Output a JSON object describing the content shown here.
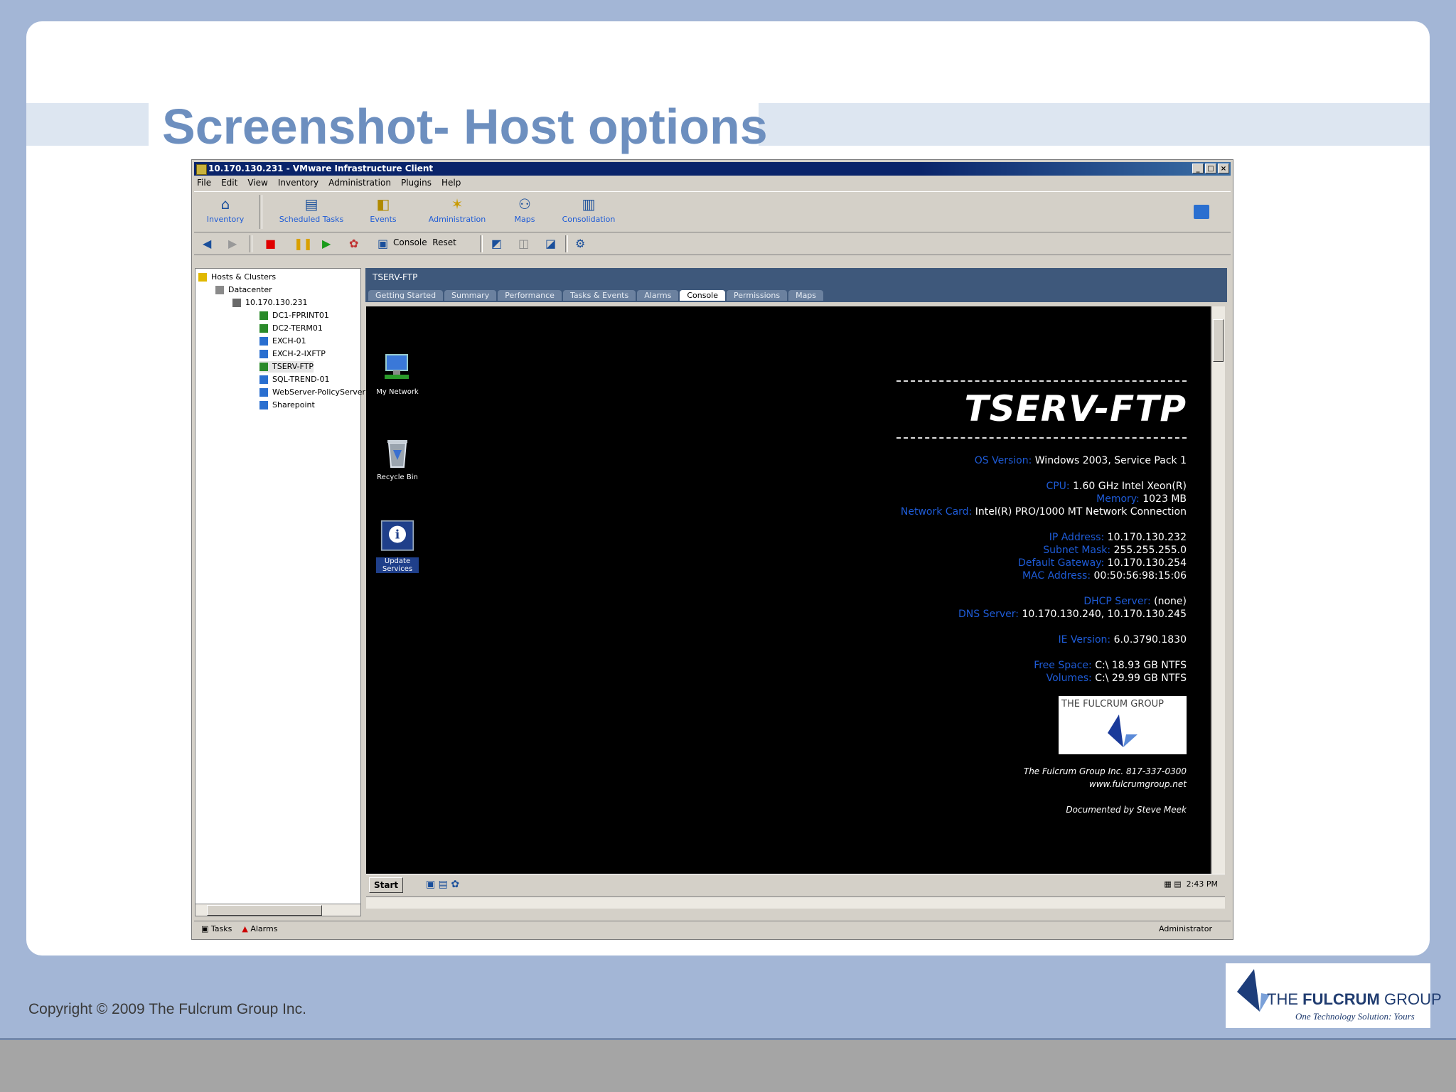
{
  "slide": {
    "title": "Screenshot- Host options",
    "copyright": "Copyright © 2009 The Fulcrum Group Inc.",
    "brand": {
      "name_pre": "THE ",
      "name_bold": "FULCRUM",
      "name_post": " GROUP",
      "tagline": "One Technology Solution: Yours"
    }
  },
  "window": {
    "title": "10.170.130.231 - VMware Infrastructure Client",
    "menu": [
      "File",
      "Edit",
      "View",
      "Inventory",
      "Administration",
      "Plugins",
      "Help"
    ],
    "toolbar": [
      "Inventory",
      "Scheduled Tasks",
      "Events",
      "Administration",
      "Maps",
      "Consolidation"
    ],
    "console_label": "Console",
    "reset_label": "Reset",
    "tree": [
      "Hosts & Clusters",
      "Datacenter",
      "10.170.130.231",
      "DC1-FPRINT01",
      "DC2-TERM01",
      "EXCH-01",
      "EXCH-2-IXFTP",
      "TSERV-FTP",
      "SQL-TREND-01",
      "WebServer-PolicyServer",
      "Sharepoint"
    ],
    "panel_title": "TSERV-FTP",
    "tabs": [
      "Getting Started",
      "Summary",
      "Performance",
      "Tasks & Events",
      "Alarms",
      "Console",
      "Permissions",
      "Maps"
    ],
    "active_tab": "Console",
    "status_left": [
      "Tasks",
      "Alarms"
    ],
    "status_right": "Administrator"
  },
  "desktop": {
    "icons": [
      "My Network",
      "Recycle Bin",
      "Update Services"
    ],
    "hostname": "TSERV-FTP",
    "lines": [
      {
        "label": "OS Version:",
        "value": "Windows 2003, Service Pack 1"
      },
      {
        "label": "CPU:",
        "value": "1.60 GHz Intel Xeon(R)"
      },
      {
        "label": "Memory:",
        "value": "1023 MB"
      },
      {
        "label": "Network Card:",
        "value": "Intel(R) PRO/1000 MT Network Connection"
      },
      {
        "label": "IP Address:",
        "value": "10.170.130.232"
      },
      {
        "label": "Subnet Mask:",
        "value": "255.255.255.0"
      },
      {
        "label": "Default Gateway:",
        "value": "10.170.130.254"
      },
      {
        "label": "MAC Address:",
        "value": "00:50:56:98:15:06"
      },
      {
        "label": "DHCP Server:",
        "value": "(none)"
      },
      {
        "label": "DNS Server:",
        "value": "10.170.130.240, 10.170.130.245"
      },
      {
        "label": "IE Version:",
        "value": "6.0.3790.1830"
      },
      {
        "label": "Free Space:",
        "value": "C:\\ 18.93 GB NTFS"
      },
      {
        "label": "Volumes:",
        "value": "C:\\ 29.99 GB NTFS"
      }
    ],
    "logo_text": "THE FULCRUM GROUP",
    "footer1": "The Fulcrum Group Inc. 817-337-0300",
    "footer2": "www.fulcrumgroup.net",
    "footer3": "Documented by Steve Meek",
    "start": "Start",
    "clock": "2:43 PM"
  }
}
